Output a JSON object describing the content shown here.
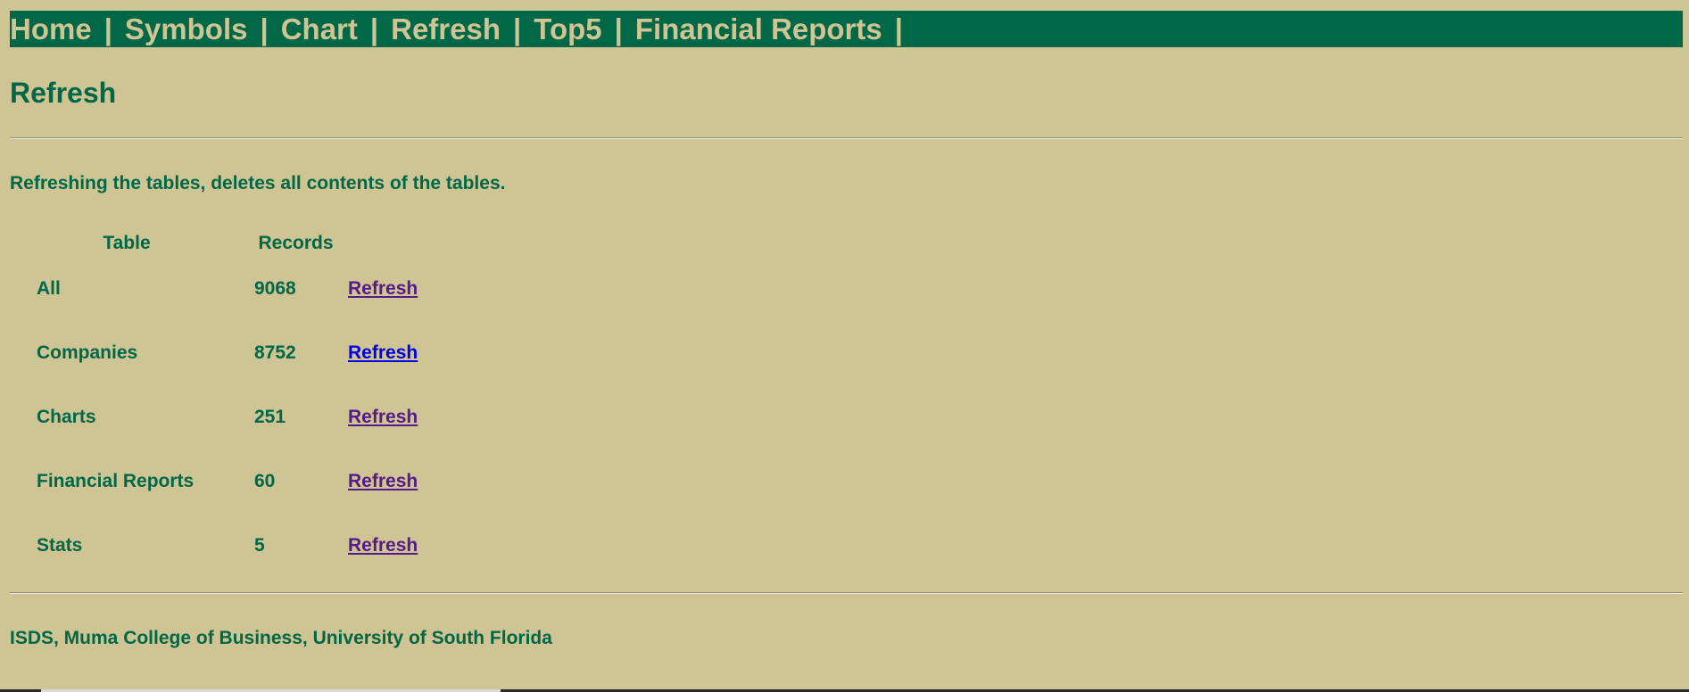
{
  "nav": {
    "items": [
      {
        "label": "Home"
      },
      {
        "label": "Symbols"
      },
      {
        "label": "Chart"
      },
      {
        "label": "Refresh"
      },
      {
        "label": "Top5"
      },
      {
        "label": "Financial Reports"
      }
    ],
    "separator": "|"
  },
  "page_title": "Refresh",
  "intro": "Refreshing the tables, deletes all contents of the tables.",
  "table": {
    "headers": {
      "table": "Table",
      "records": "Records"
    },
    "rows": [
      {
        "name": "All",
        "records": "9068",
        "action": "Refresh"
      },
      {
        "name": "Companies",
        "records": "8752",
        "action": "Refresh"
      },
      {
        "name": "Charts",
        "records": "251",
        "action": "Refresh"
      },
      {
        "name": "Financial Reports",
        "records": "60",
        "action": "Refresh"
      },
      {
        "name": "Stats",
        "records": "5",
        "action": "Refresh"
      }
    ]
  },
  "footer": "ISDS, Muma College of Business, University of South Florida",
  "colors": {
    "background": "#CFC493",
    "primary": "#006747",
    "visited_link": "#551A8B",
    "link": "#0000EE"
  }
}
